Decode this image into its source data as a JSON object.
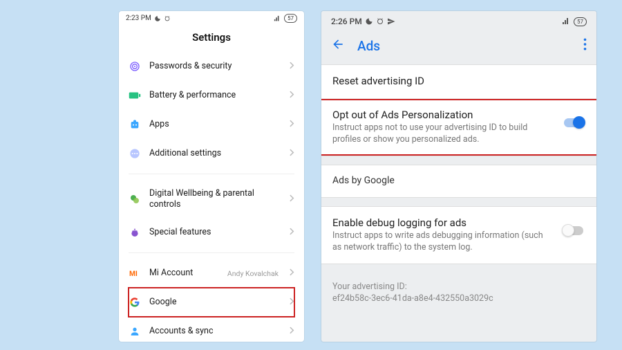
{
  "phone1": {
    "status": {
      "time": "2:23 PM",
      "moon": "☾",
      "alarm": "⏰",
      "signal": "📶",
      "battery": "57"
    },
    "header": "Settings",
    "groups": [
      {
        "items": [
          {
            "icon": "fingerprint",
            "label": "Passwords & security"
          },
          {
            "icon": "battery",
            "label": "Battery & performance"
          },
          {
            "icon": "apps",
            "label": "Apps"
          },
          {
            "icon": "more",
            "label": "Additional settings"
          }
        ]
      },
      {
        "items": [
          {
            "icon": "wellbeing",
            "label": "Digital Wellbeing & parental controls"
          },
          {
            "icon": "special",
            "label": "Special features"
          }
        ]
      },
      {
        "items": [
          {
            "icon": "mi",
            "label": "Mi Account",
            "value": "Andy Kovalchak"
          },
          {
            "icon": "google",
            "label": "Google",
            "highlight": true
          },
          {
            "icon": "sync",
            "label": "Accounts & sync"
          }
        ]
      }
    ]
  },
  "phone2": {
    "status": {
      "time": "2:26 PM",
      "moon": "☾",
      "alarm": "⏰",
      "send": "➤",
      "signal": "📶",
      "battery": "57"
    },
    "toolbar": {
      "title": "Ads"
    },
    "section1": {
      "reset": {
        "title": "Reset advertising ID"
      },
      "optout": {
        "title": "Opt out of Ads Personalization",
        "desc": "Instruct apps not to use your advertising ID to build profiles or show you personalized ads.",
        "highlight": true,
        "toggle_on": true,
        "name": "opt-out-toggle"
      }
    },
    "section_header": "Ads by Google",
    "section2": {
      "debug": {
        "title": "Enable debug logging for ads",
        "desc": "Instruct apps to write ads debugging information (such as network traffic) to the system log.",
        "toggle_on": false,
        "name": "debug-toggle"
      }
    },
    "footer": {
      "label": "Your advertising ID:",
      "id": "ef24b58c-3ec6-41da-a8e4-432550a3029c"
    }
  }
}
